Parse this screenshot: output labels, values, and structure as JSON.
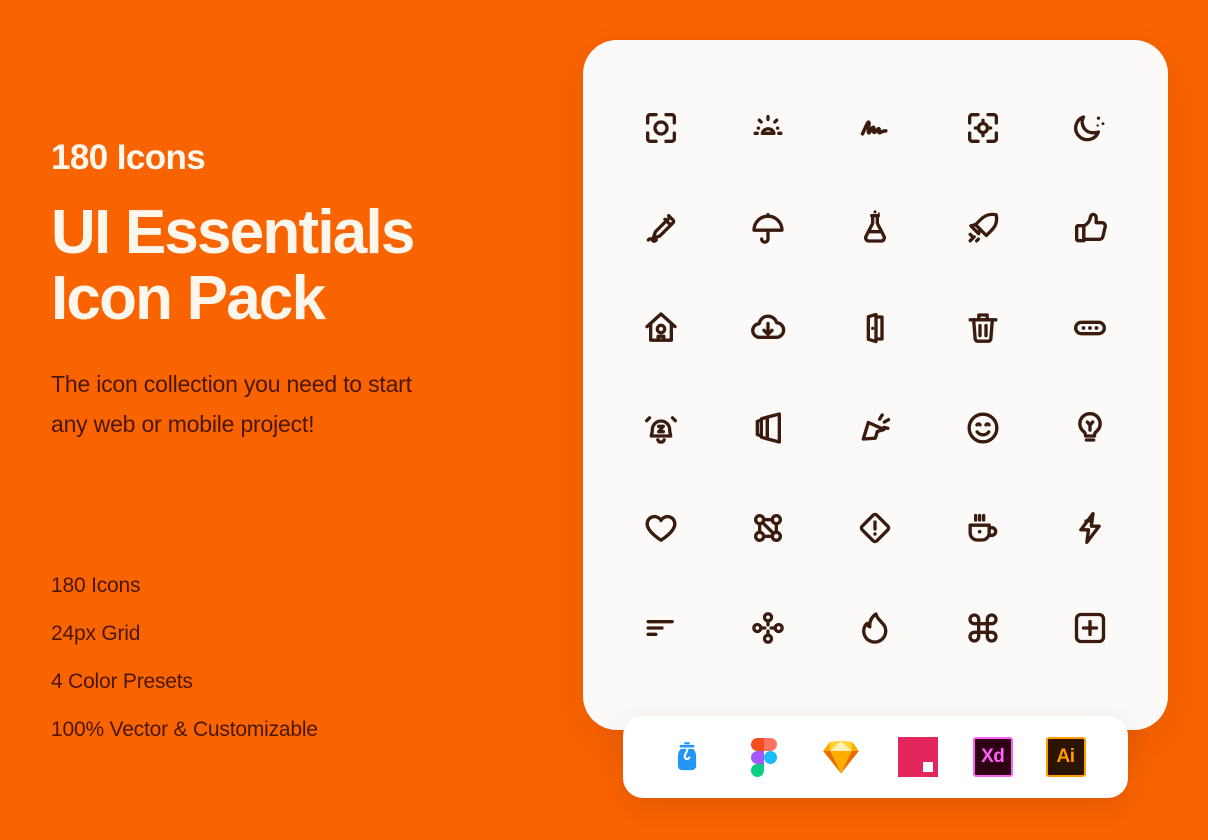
{
  "theme": {
    "background_color": "#FA6400",
    "card_color": "#FBFAF8",
    "apps_bar_color": "#FFFFFF",
    "headline_color": "#FDF6EC",
    "body_text_color": "#4A1605",
    "icon_stroke_color": "#3A1B0E"
  },
  "hero": {
    "eyebrow": "180 Icons",
    "headline": "UI Essentials\nIcon Pack",
    "subhead": "The icon collection you need to start\nany web or mobile project!"
  },
  "features": [
    {
      "label": "180 Icons"
    },
    {
      "label": "24px Grid"
    },
    {
      "label": "4 Color Presets"
    },
    {
      "label": "100% Vector & Customizable"
    }
  ],
  "icon_grid": {
    "columns": 5,
    "rows": 6,
    "icons": [
      {
        "name": "focus-frame-circle-icon",
        "label": "Focus"
      },
      {
        "name": "sunrise-icon",
        "label": "Sunrise"
      },
      {
        "name": "signature-icon",
        "label": "Signature"
      },
      {
        "name": "focus-target-icon",
        "label": "Focus Target"
      },
      {
        "name": "moon-stars-icon",
        "label": "Night"
      },
      {
        "name": "pen-write-icon",
        "label": "Write"
      },
      {
        "name": "umbrella-icon",
        "label": "Umbrella"
      },
      {
        "name": "flask-icon",
        "label": "Lab Flask"
      },
      {
        "name": "rocket-icon",
        "label": "Rocket"
      },
      {
        "name": "thumbs-up-icon",
        "label": "Like"
      },
      {
        "name": "home-icon",
        "label": "Home"
      },
      {
        "name": "cloud-download-icon",
        "label": "Cloud Download"
      },
      {
        "name": "door-exit-icon",
        "label": "Exit"
      },
      {
        "name": "trash-icon",
        "label": "Delete"
      },
      {
        "name": "more-horizontal-icon",
        "label": "More"
      },
      {
        "name": "alarm-snooze-icon",
        "label": "Snooze"
      },
      {
        "name": "book-open-icon",
        "label": "Book"
      },
      {
        "name": "cursor-click-icon",
        "label": "Click"
      },
      {
        "name": "smiley-face-icon",
        "label": "Smile"
      },
      {
        "name": "lightbulb-icon",
        "label": "Idea"
      },
      {
        "name": "heart-icon",
        "label": "Favorite"
      },
      {
        "name": "nodes-selection-icon",
        "label": "Nodes"
      },
      {
        "name": "warning-diamond-icon",
        "label": "Warning"
      },
      {
        "name": "coffee-cup-icon",
        "label": "Coffee"
      },
      {
        "name": "lightning-bolt-icon",
        "label": "Flash"
      },
      {
        "name": "align-left-icon",
        "label": "Align"
      },
      {
        "name": "cluster-nodes-icon",
        "label": "Cluster"
      },
      {
        "name": "flame-icon",
        "label": "Trending"
      },
      {
        "name": "command-key-icon",
        "label": "Command"
      },
      {
        "name": "plus-square-icon",
        "label": "Add"
      }
    ]
  },
  "apps_bar": {
    "apps": [
      {
        "name": "iconjar-logo",
        "label": "IconJar",
        "color": "#2196F3"
      },
      {
        "name": "figma-logo",
        "label": "Figma",
        "color": "#F24E1E"
      },
      {
        "name": "sketch-logo",
        "label": "Sketch",
        "color": "#FDB300"
      },
      {
        "name": "invision-studio-logo",
        "label": "InVision Studio",
        "color": "#E3265E"
      },
      {
        "name": "adobe-xd-logo",
        "label": "Xd",
        "color": "#FF61F6"
      },
      {
        "name": "adobe-illustrator-logo",
        "label": "Ai",
        "color": "#FF9A00"
      }
    ]
  }
}
